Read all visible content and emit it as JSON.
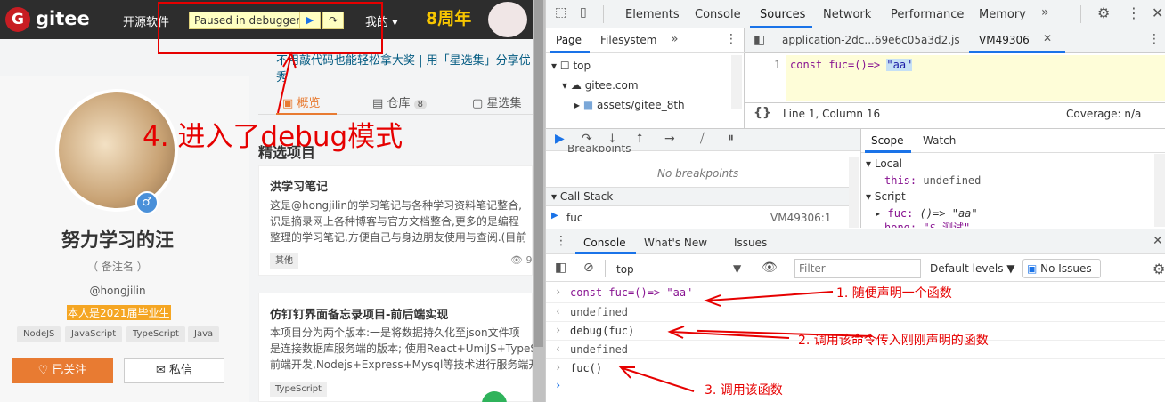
{
  "left_page": {
    "brand": "gitee",
    "logo_letter": "G",
    "nav_open_source": "开源软件",
    "nav_mine": "我的",
    "paused_label": "Paused in debugger",
    "badge_anniversary": "8周年",
    "banner_text": "不用敲代码也能轻松拿大奖 | 用「星选集」分享优秀",
    "tabs": [
      {
        "label": "概览"
      },
      {
        "label": "仓库",
        "count": "8"
      },
      {
        "label": "星选集"
      }
    ],
    "profile": {
      "name": "努力学习的汪",
      "remark": "（ 备注名 ）",
      "handle": "@hongjilin",
      "bio": "本人是2021届毕业生",
      "tags": [
        "NodeJS",
        "JavaScript",
        "TypeScript",
        "Java"
      ],
      "followed_label": "已关注",
      "message_label": "私信"
    },
    "featured_title": "精选项目",
    "projects": [
      {
        "title": "洪学习笔记",
        "desc": [
          "这是@hongjilin的学习笔记与各种学习资料笔记整合,",
          "识是摘录网上各种博客与官方文档整合,更多的是编程",
          "整理的学习笔记,方便自己与身边朋友使用与查阅.(目前"
        ],
        "lang": "其他",
        "views": "9"
      },
      {
        "title": "仿钉钉界面备忘录项目-前后端实现",
        "desc": [
          "本项目分为两个版本:一是将数据持久化至json文件项",
          "是连接数据库服务端的版本; 使用React+UmiJS+TypeS",
          "前端开发,Nodejs+Express+Mysql等技术进行服务端开"
        ],
        "lang": "TypeScript"
      }
    ],
    "annotation_4": "4. 进入了debug模式"
  },
  "devtools": {
    "top_tabs": [
      "Elements",
      "Console",
      "Sources",
      "Network",
      "Performance",
      "Memory"
    ],
    "active_top_tab": "Sources",
    "nav_tabs": [
      "Page",
      "Filesystem"
    ],
    "tree": [
      {
        "label": "top"
      },
      {
        "label": "gitee.com"
      },
      {
        "label": "assets/gitee_8th"
      }
    ],
    "file_tabs": [
      {
        "label": "application-2dc...69e6c05a3d2.js"
      },
      {
        "label": "VM49306"
      }
    ],
    "code_line_no": "1",
    "code": {
      "prefix": "const fuc=()=> ",
      "string": "\"aa\""
    },
    "status_position": "Line 1, Column 16",
    "status_coverage": "Coverage: n/a",
    "breakpoints_header": "Breakpoints",
    "no_breakpoints": "No breakpoints",
    "call_stack_header": "Call Stack",
    "call_stack": [
      {
        "fn": "fuc",
        "loc": "VM49306:1"
      }
    ],
    "scope_tabs": [
      "Scope",
      "Watch"
    ],
    "scope": {
      "local_header": "Local",
      "this_key": "this:",
      "this_val": "undefined",
      "script_header": "Script",
      "fuc_key": "fuc:",
      "fuc_val": "()=> \"aa\"",
      "hong_row": "hong: \"$ 测试\""
    },
    "drawer_tabs": [
      "Console",
      "What's New",
      "Issues"
    ],
    "console_toolbar": {
      "context": "top",
      "filter_placeholder": "Filter",
      "levels": "Default levels",
      "issues": "No Issues"
    },
    "console_lines": [
      {
        "type": "input",
        "text": "const fuc=()=> \"aa\""
      },
      {
        "type": "output",
        "text": "undefined"
      },
      {
        "type": "input",
        "text": "debug(fuc)"
      },
      {
        "type": "output",
        "text": "undefined"
      },
      {
        "type": "input",
        "text": "fuc()"
      }
    ],
    "annotations": [
      "1. 随便声明一个函数",
      "2. 调用该命令传入刚刚声明的函数",
      "3. 调用该函数"
    ]
  },
  "colors": {
    "annotation_red": "#e60000",
    "devtools_blue": "#1a73e8",
    "gitee_red": "#c71d23"
  }
}
